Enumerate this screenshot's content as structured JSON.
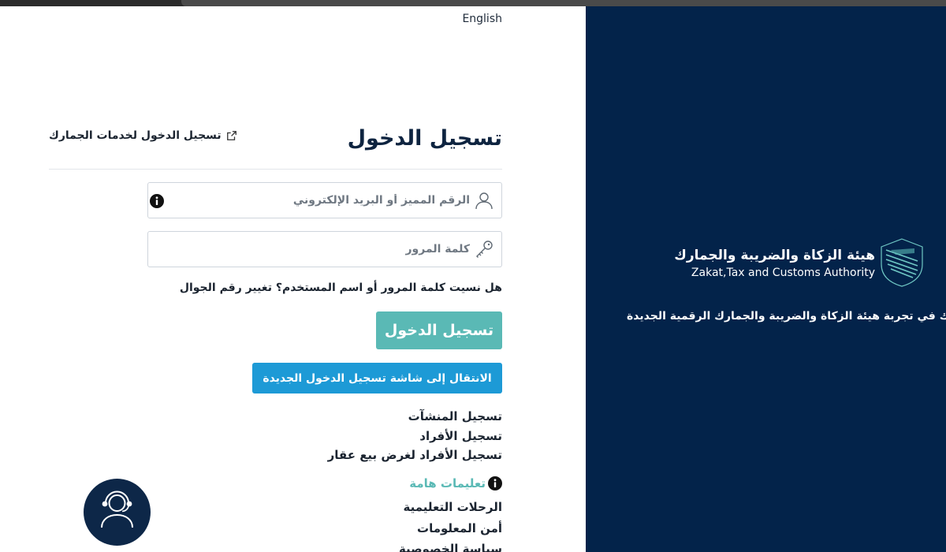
{
  "window": {
    "language_link": "English"
  },
  "login": {
    "title": "تسجيل الدخول",
    "customs_link": "تسجيل الدخول لخدمات الجمارك",
    "username_placeholder": "الرقم المميز أو البريد الإلكتروني",
    "password_placeholder": "كلمة المرور",
    "forgot_prefix": "هل نسيت ",
    "forgot_password": "كلمة المرور",
    "forgot_or": " أو ",
    "forgot_username": "اسم المستخدم",
    "forgot_q": "؟ ",
    "change_mobile": "تغيير رقم الجوال",
    "login_button": "تسجيل الدخول",
    "new_login_button": "الانتقال إلى شاشة تسجيل الدخول الجديدة"
  },
  "registration": {
    "links": [
      "تسجيل المنشآت",
      "تسجيل الأفراد",
      "تسجيل الأفراد لغرض بيع عقار"
    ]
  },
  "info": {
    "important_instructions": "تعليمات هامة",
    "links": [
      "الرحلات التعليمية",
      "أمن المعلومات",
      "سياسة الخصوصية"
    ]
  },
  "brand": {
    "name_ar": "هيئة الزكاة والضريبة والجمارك",
    "name_en": "Zakat,Tax and Customs Authority",
    "welcome": "بك في تجربة هيئة الزكاة والضريبة والجمارك الرقمية الجديدة"
  },
  "icons": {
    "user": "user-icon",
    "key": "key-icon",
    "info": "info-icon",
    "external": "external-link-icon",
    "support": "support-agent-icon",
    "logo": "zatca-logo"
  },
  "colors": {
    "primary_dark": "#03234a",
    "teal": "#5ab9b5",
    "blue": "#1d9ad6"
  }
}
